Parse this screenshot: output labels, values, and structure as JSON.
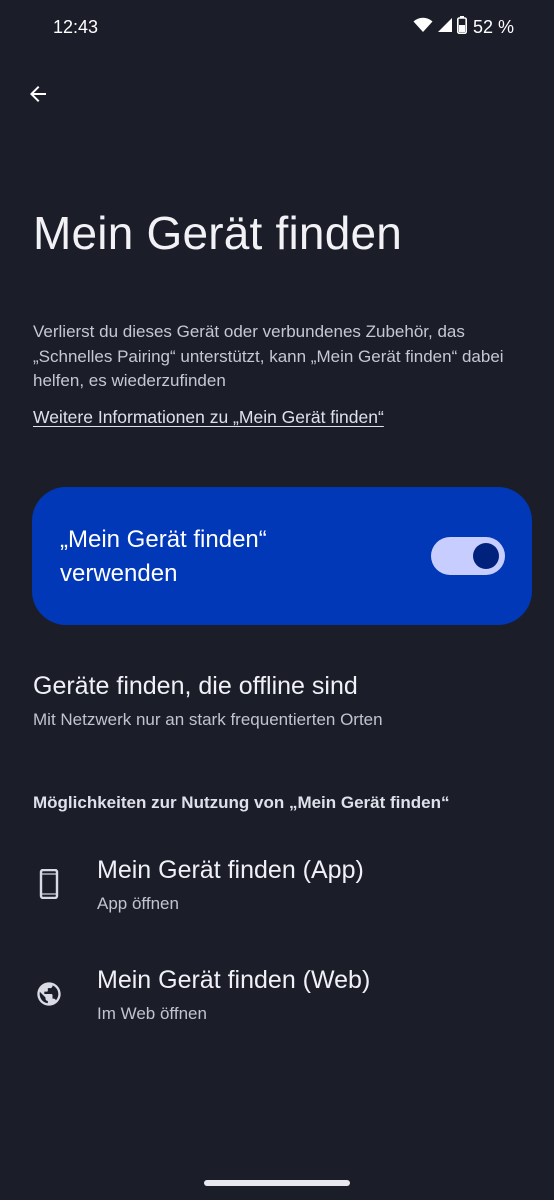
{
  "status_bar": {
    "time": "12:43",
    "battery_pct": "52 %"
  },
  "header": {
    "back_icon": "arrow-back-icon",
    "title": "Mein Gerät finden"
  },
  "description": "Verlierst du dieses Gerät oder verbundenes Zubehör, das „Schnelles Pairing“ unterstützt, kann „Mein Gerät finden“ dabei helfen, es wiederzufinden",
  "info_link": "Weitere Informationen zu „Mein Gerät finden“",
  "main_toggle": {
    "label": "„Mein Gerät finden“ verwenden",
    "checked": true
  },
  "offline": {
    "title": "Geräte finden, die offline sind",
    "subtitle": "Mit Netzwerk nur an stark frequentierten Orten"
  },
  "section": {
    "header": "Möglichkeiten zur Nutzung von „Mein Gerät finden“"
  },
  "items": [
    {
      "icon": "phone-icon",
      "title": "Mein Gerät finden (App)",
      "subtitle": "App öffnen"
    },
    {
      "icon": "globe-icon",
      "title": "Mein Gerät finden (Web)",
      "subtitle": "Im Web öffnen"
    }
  ],
  "colors": {
    "background": "#1b1e29",
    "card": "#0038b8",
    "switch_track": "#c7cdff",
    "switch_thumb": "#00227d"
  }
}
